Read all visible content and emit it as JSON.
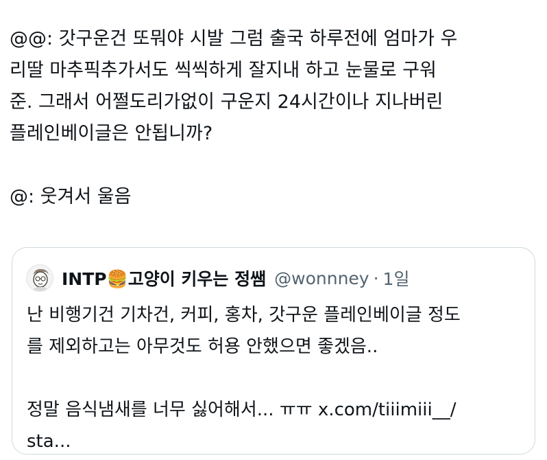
{
  "tweet": {
    "lines": [
      "@@: 갓구운건 또뭐야 시발 그럼 출국 하루전에 엄마가 우",
      "리딸 마추픽추가서도 씩씩하게 잘지내 하고 눈물로 구워",
      "준. 그래서 어쩔도리가없이 구운지 24시간이나 지나버린",
      "플레인베이글은 안됩니까?"
    ],
    "reply": "@: 웃겨서 울음"
  },
  "quote": {
    "display_name": "INTP🍔고양이 키우는 정쌤",
    "handle": "@wonnney",
    "separator": "·",
    "time": "1일",
    "lines": [
      "난 비행기건 기차건, 커피, 홍차, 갓구운 플레인베이글 정도",
      "를 제외하고는 아무것도 허용 안했으면 좋겠음.."
    ],
    "lines2": [
      "정말 음식냄새를 너무 싫어해서... ㅠㅠ x.com/tiiimiii__/",
      "sta..."
    ]
  },
  "icons": {
    "avatar": "cartoon-face-avatar-icon"
  }
}
